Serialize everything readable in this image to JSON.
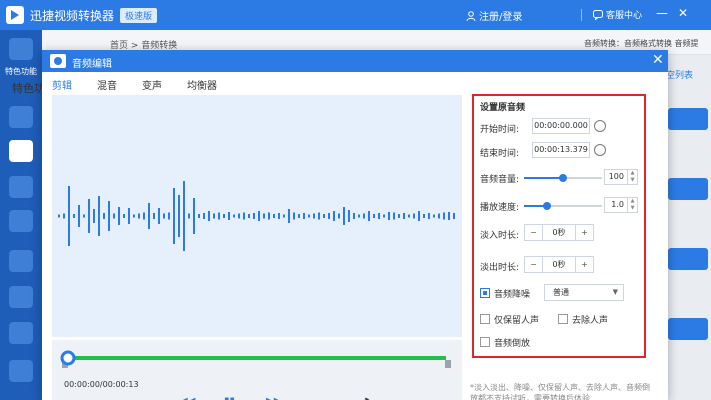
{
  "app": {
    "title": "迅捷视频转换器",
    "edition": "极速版",
    "login": "注册/登录",
    "service": "客服中心",
    "min_icon": "—",
    "close_icon": "✕"
  },
  "sidebar": {
    "featured_label": "特色功能"
  },
  "main": {
    "breadcrumb": "首页 > 音频转换",
    "right_note": "音频转换：音频格式转换 音频提",
    "featured_section": "特色功",
    "clear_link": "空列表"
  },
  "modal": {
    "title": "音频编辑",
    "close": "✕",
    "tabs": [
      {
        "label": "剪辑",
        "active": true
      },
      {
        "label": "混音",
        "active": false
      },
      {
        "label": "变声",
        "active": false
      },
      {
        "label": "均衡器",
        "active": false
      }
    ],
    "time_readout": "00:00:00/00:00:13",
    "controls": {
      "rewind": "◀◀",
      "pause": "▮▮",
      "forward": "▶▶",
      "volume": "🔈"
    }
  },
  "settings": {
    "title": "设置原音频",
    "start_label": "开始时间:",
    "start_value": "00:00:00.000",
    "end_label": "结束时间:",
    "end_value": "00:00:13.379",
    "volume_label": "音频音量:",
    "volume_value": "100",
    "volume_fraction": 0.5,
    "speed_label": "播放速度:",
    "speed_value": "1.0",
    "speed_fraction": 0.3,
    "fade_in_label": "淡入时长:",
    "fade_in_value": "0秒",
    "fade_out_label": "淡出时长:",
    "fade_out_value": "0秒",
    "minus": "−",
    "plus": "+",
    "denoise_label": "音频降噪",
    "denoise_checked": true,
    "denoise_option": "普通",
    "keep_voice_label": "仅保留人声",
    "remove_voice_label": "去除人声",
    "reverse_label": "音频倒放"
  },
  "footnote": "*淡入淡出、降噪、仅保留人声、去除人声、音频倒放都不支持试听，需要转换后体验"
}
